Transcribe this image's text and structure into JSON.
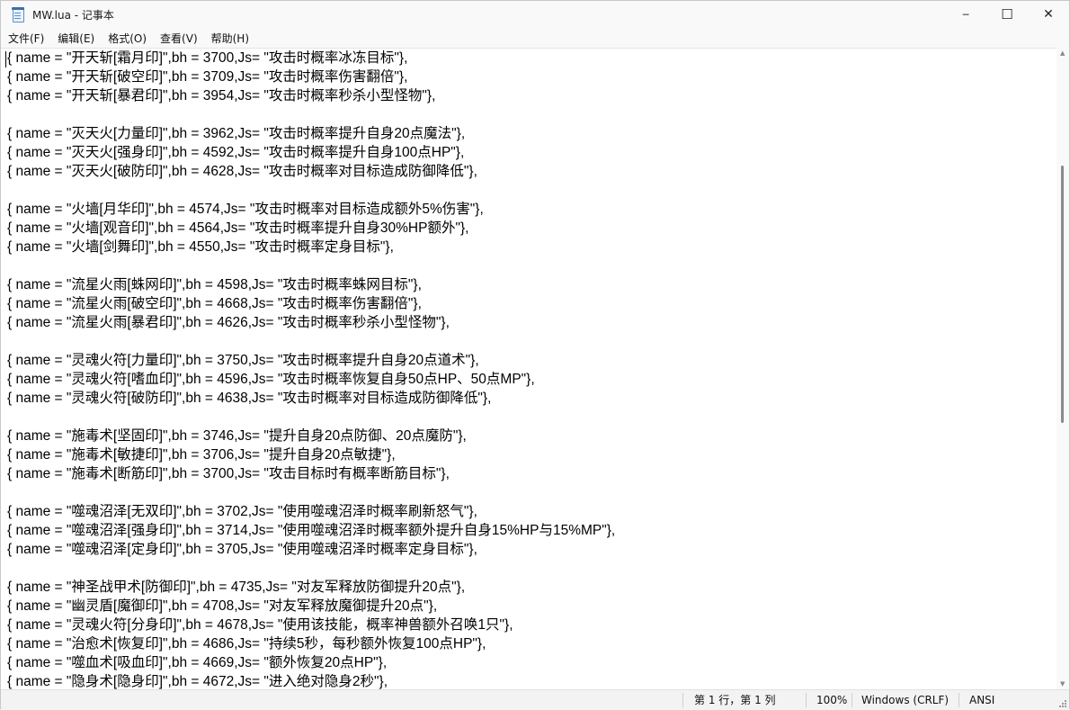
{
  "window": {
    "title": "MW.lua - 记事本",
    "controls": {
      "minimize": "─",
      "maximize": "☐",
      "close": "✕"
    }
  },
  "menu": [
    "文件(F)",
    "编辑(E)",
    "格式(O)",
    "查看(V)",
    "帮助(H)"
  ],
  "editor": {
    "lines": [
      "{ name = \"开天斩[霜月印]\",bh = 3700,Js= \"攻击时概率冰冻目标\"},",
      "{ name = \"开天斩[破空印]\",bh = 3709,Js= \"攻击时概率伤害翻倍\"},",
      "{ name = \"开天斩[暴君印]\",bh = 3954,Js= \"攻击时概率秒杀小型怪物\"},",
      "",
      "{ name = \"灭天火[力量印]\",bh = 3962,Js= \"攻击时概率提升自身20点魔法\"},",
      "{ name = \"灭天火[强身印]\",bh = 4592,Js= \"攻击时概率提升自身100点HP\"},",
      "{ name = \"灭天火[破防印]\",bh = 4628,Js= \"攻击时概率对目标造成防御降低\"},",
      "",
      "{ name = \"火墙[月华印]\",bh = 4574,Js= \"攻击时概率对目标造成额外5%伤害\"},",
      "{ name = \"火墙[观音印]\",bh = 4564,Js= \"攻击时概率提升自身30%HP额外\"},",
      "{ name = \"火墙[剑舞印]\",bh = 4550,Js= \"攻击时概率定身目标\"},",
      "",
      "{ name = \"流星火雨[蛛网印]\",bh = 4598,Js= \"攻击时概率蛛网目标\"},",
      "{ name = \"流星火雨[破空印]\",bh = 4668,Js= \"攻击时概率伤害翻倍\"},",
      "{ name = \"流星火雨[暴君印]\",bh = 4626,Js= \"攻击时概率秒杀小型怪物\"},",
      "",
      "{ name = \"灵魂火符[力量印]\",bh = 3750,Js= \"攻击时概率提升自身20点道术\"},",
      "{ name = \"灵魂火符[嗜血印]\",bh = 4596,Js= \"攻击时概率恢复自身50点HP、50点MP\"},",
      "{ name = \"灵魂火符[破防印]\",bh = 4638,Js= \"攻击时概率对目标造成防御降低\"},",
      "",
      "{ name = \"施毒术[坚固印]\",bh = 3746,Js= \"提升自身20点防御、20点魔防\"},",
      "{ name = \"施毒术[敏捷印]\",bh = 3706,Js= \"提升自身20点敏捷\"},",
      "{ name = \"施毒术[断筋印]\",bh = 3700,Js= \"攻击目标时有概率断筋目标\"},",
      "",
      "{ name = \"噬魂沼泽[无双印]\",bh = 3702,Js= \"使用噬魂沼泽时概率刷新怒气\"},",
      "{ name = \"噬魂沼泽[强身印]\",bh = 3714,Js= \"使用噬魂沼泽时概率额外提升自身15%HP与15%MP\"},",
      "{ name = \"噬魂沼泽[定身印]\",bh = 3705,Js= \"使用噬魂沼泽时概率定身目标\"},",
      "",
      "{ name = \"神圣战甲术[防御印]\",bh = 4735,Js= \"对友军释放防御提升20点\"},",
      "{ name = \"幽灵盾[魔御印]\",bh = 4708,Js= \"对友军释放魔御提升20点\"},",
      "{ name = \"灵魂火符[分身印]\",bh = 4678,Js= \"使用该技能，概率神兽额外召唤1只\"},",
      "{ name = \"治愈术[恢复印]\",bh = 4686,Js= \"持续5秒，每秒额外恢复100点HP\"},",
      "{ name = \"噬血术[吸血印]\",bh = 4669,Js= \"额外恢复20点HP\"},",
      "{ name = \"隐身术[隐身印]\",bh = 4672,Js= \"进入绝对隐身2秒\"},"
    ]
  },
  "status": {
    "position": "第 1 行，第 1 列",
    "zoom": "100%",
    "line_ending": "Windows (CRLF)",
    "encoding": "ANSI"
  }
}
